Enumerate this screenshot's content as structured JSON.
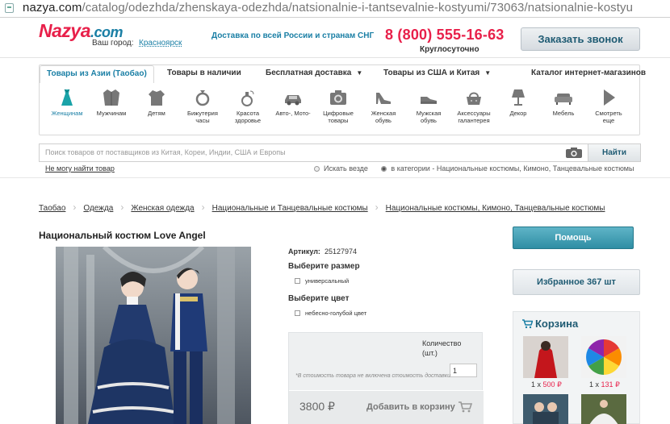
{
  "browser": {
    "url_domain": "nazya.com",
    "url_path": "/catalog/odezhda/zhenskaya-odezhda/natsionalnie-i-tantsevalnie-kostyumi/73063/natsionalnie-kostyu"
  },
  "header": {
    "logo_text": "Nazya",
    "logo_tld": ".com",
    "city_label": "Ваш город:",
    "city_value": "Красноярск",
    "delivery_text": "Доставка по всей России и странам СНГ",
    "phone": "8 (800) 555-16-63",
    "phone_hours": "Круглосуточно",
    "call_button": "Заказать звонок"
  },
  "nav": {
    "tabs": [
      {
        "label": "Товары из Азии (Таобао)",
        "active": true,
        "has_dropdown": false
      },
      {
        "label": "Товары в наличии",
        "active": false,
        "has_dropdown": false
      },
      {
        "label": "Бесплатная доставка",
        "active": false,
        "has_dropdown": true
      },
      {
        "label": "Товары из США и Китая",
        "active": false,
        "has_dropdown": true
      },
      {
        "label": "Каталог интернет-магазинов",
        "active": false,
        "has_dropdown": false
      }
    ],
    "categories": [
      {
        "icon": "dress-icon",
        "label1": "Женщинам",
        "label2": ""
      },
      {
        "icon": "jacket-icon",
        "label1": "Мужчинам",
        "label2": ""
      },
      {
        "icon": "kids-shirt-icon",
        "label1": "Детям",
        "label2": ""
      },
      {
        "icon": "ring-icon",
        "label1": "Бижутерия",
        "label2": "часы"
      },
      {
        "icon": "perfume-icon",
        "label1": "Красота",
        "label2": "здоровье"
      },
      {
        "icon": "car-icon",
        "label1": "Авто-, Мото-",
        "label2": ""
      },
      {
        "icon": "camera-icon",
        "label1": "Цифровые",
        "label2": "товары"
      },
      {
        "icon": "heel-shoe-icon",
        "label1": "Женская",
        "label2": "обувь"
      },
      {
        "icon": "men-shoe-icon",
        "label1": "Мужская",
        "label2": "обувь"
      },
      {
        "icon": "handbag-icon",
        "label1": "Аксессуары",
        "label2": "галантерея"
      },
      {
        "icon": "lamp-icon",
        "label1": "Декор",
        "label2": ""
      },
      {
        "icon": "sofa-icon",
        "label1": "Мебель",
        "label2": ""
      },
      {
        "icon": "play-arrow-icon",
        "label1": "Смотреть",
        "label2": "еще"
      }
    ]
  },
  "search": {
    "placeholder": "Поиск товаров от поставщиков из Китая, Кореи, Индии, США и Европы",
    "button": "Найти",
    "not_found_link": "Не могу найти товар",
    "option_everywhere": "Искать везде",
    "option_category": "в категории - Национальные костюмы, Кимоно, Танцевальные костюмы",
    "selected_option": "category"
  },
  "breadcrumbs": [
    "Таобао",
    "Одежда",
    "Женская одежда",
    "Национальные и Танцевальные костюмы",
    "Национальные костюмы, Кимоно, Танцевальные костюмы"
  ],
  "product": {
    "title": "Национальный костюм Love Angel",
    "article_label": "Артикул:",
    "article_value": "25127974",
    "size_heading": "Выберите размер",
    "size_option": "универсальный",
    "color_heading": "Выберите цвет",
    "color_option": "небесно-голубой цвет",
    "qty_label": "Количество (шт.)",
    "qty_value": "1",
    "disclaimer": "*В стоимость товара не включена стоимость доставки",
    "price": "3800 ₽",
    "add_to_cart": "Добавить в корзину"
  },
  "sidebar": {
    "help_button": "Помощь",
    "favorites_button": "Избранное 367 шт",
    "cart_title": "Корзина",
    "cart_items": [
      {
        "caption_qty": "1 x",
        "caption_price": "500",
        "currency": "₽"
      },
      {
        "caption_qty": "1 x",
        "caption_price": "131",
        "currency": "₽"
      }
    ]
  },
  "colors": {
    "brand_red": "#e8204a",
    "brand_blue": "#1a7fa5",
    "help_button": "#2f8ea4"
  }
}
